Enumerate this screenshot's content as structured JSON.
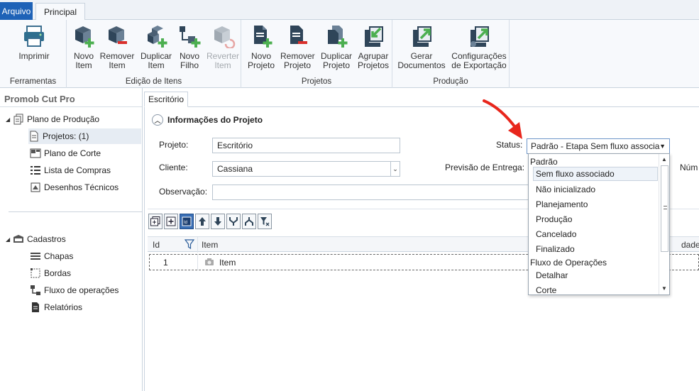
{
  "ribbon_tabs": {
    "file": "Arquivo",
    "main": "Principal"
  },
  "groups": {
    "tools": {
      "title": "Ferramentas",
      "print": [
        "Imprimir",
        ""
      ]
    },
    "items": {
      "title": "Edição de Itens",
      "new": [
        "Novo",
        "Item"
      ],
      "remove": [
        "Remover",
        "Item"
      ],
      "duplicate": [
        "Duplicar",
        "Item"
      ],
      "new_child": [
        "Novo",
        "Filho"
      ],
      "revert": [
        "Reverter",
        "Item"
      ]
    },
    "projects": {
      "title": "Projetos",
      "new": [
        "Novo",
        "Projeto"
      ],
      "remove": [
        "Remover",
        "Projeto"
      ],
      "duplicate": [
        "Duplicar",
        "Projeto"
      ],
      "group": [
        "Agrupar",
        "Projetos"
      ]
    },
    "production": {
      "title": "Produção",
      "generate": [
        "Gerar",
        "Documentos"
      ],
      "export": [
        "Configurações",
        "de Exportação"
      ]
    }
  },
  "tree": {
    "title": "Promob Cut Pro",
    "plan": "Plano de Produção",
    "projects": "Projetos: (1)",
    "cut_plan": "Plano de Corte",
    "shopping": "Lista de Compras",
    "drawings": "Desenhos Técnicos",
    "registry": "Cadastros",
    "sheets": "Chapas",
    "edges": "Bordas",
    "ops_flow": "Fluxo de operações",
    "reports": "Relatórios"
  },
  "doc_tab": "Escritório",
  "project_info": {
    "header": "Informações do Projeto",
    "project_label": "Projeto:",
    "project_value": "Escritório",
    "client_label": "Cliente:",
    "client_value": "Cassiana",
    "obs_label": "Observação:",
    "obs_value": "",
    "status_label": "Status:",
    "status_value": "Padrão - Etapa Sem fluxo associa",
    "delivery_label": "Previsão de Entrega:",
    "number_label_partial": "Núm"
  },
  "status_dropdown": {
    "groups": [
      {
        "label": "Padrão",
        "options": [
          "Sem fluxo associado",
          "Não inicializado",
          "Planejamento",
          "Produção",
          "Cancelado",
          "Finalizado"
        ]
      },
      {
        "label": "Fluxo de Operações",
        "options": [
          "Detalhar",
          "Corte"
        ]
      }
    ],
    "highlighted": "Sem fluxo associado"
  },
  "grid": {
    "headers": {
      "id": "Id",
      "item": "Item",
      "qty_partial": "dade"
    },
    "rows": [
      {
        "id": "1",
        "item": "Item"
      }
    ]
  },
  "toolbar_icons": [
    "expand-all-icon",
    "collapse-all-icon",
    "id-toggle-icon",
    "move-up-icon",
    "move-down-icon",
    "merge-icon",
    "split-icon",
    "clear-filter-icon"
  ],
  "colors": {
    "accent": "#1e62b7",
    "green": "#5cb85c",
    "red": "#d9302c",
    "annotation_arrow": "#e8261c"
  }
}
